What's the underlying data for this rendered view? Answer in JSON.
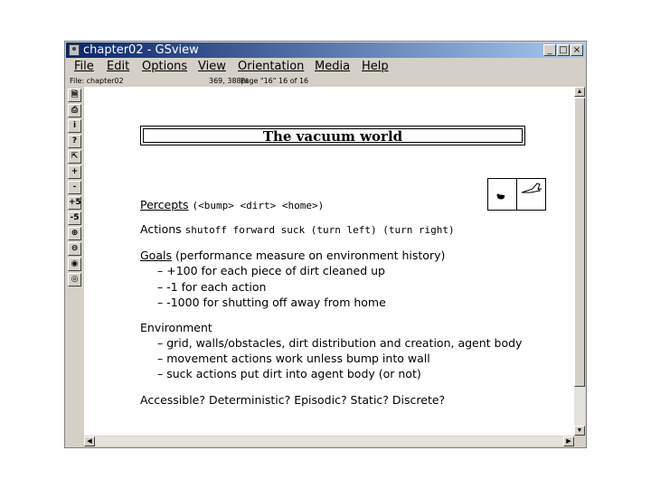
{
  "window": {
    "title": "chapter02 - GSview",
    "minimize_glyph": "_",
    "maximize_glyph": "□",
    "close_glyph": "×"
  },
  "menu": {
    "items": [
      {
        "label": "File"
      },
      {
        "label": "Edit"
      },
      {
        "label": "Options"
      },
      {
        "label": "View"
      },
      {
        "label": "Orientation"
      },
      {
        "label": "Media"
      },
      {
        "label": "Help"
      }
    ]
  },
  "status": {
    "file": "File: chapter02",
    "position": "369, 388pt",
    "page": "Page \"16\"   16 of 16"
  },
  "toolbar": {
    "buttons": [
      {
        "icon": "open-file-icon",
        "glyph": "🗎"
      },
      {
        "icon": "print-icon",
        "glyph": "⎙"
      },
      {
        "icon": "info-icon",
        "glyph": "i"
      },
      {
        "icon": "help-icon",
        "glyph": "?"
      },
      {
        "icon": "goto-page-icon",
        "glyph": "⇱"
      },
      {
        "icon": "next-page-icon",
        "glyph": "+"
      },
      {
        "icon": "prev-page-icon",
        "glyph": "-"
      },
      {
        "icon": "skip-forward-icon",
        "glyph": "+5"
      },
      {
        "icon": "skip-back-icon",
        "glyph": "-5"
      },
      {
        "icon": "zoom-in-icon",
        "glyph": "⊕"
      },
      {
        "icon": "zoom-out-icon",
        "glyph": "⊖"
      },
      {
        "icon": "find-icon",
        "glyph": "◉"
      },
      {
        "icon": "find-next-icon",
        "glyph": "◎"
      }
    ]
  },
  "slide": {
    "title": "The vacuum world",
    "percepts_label": "Percepts",
    "percepts_value": "(<bump> <dirt> <home>)",
    "actions_label": "Actions",
    "actions_value": "shutoff forward suck (turn left) (turn right)",
    "goals_label": "Goals",
    "goals_value": "(performance measure on environment history)",
    "goals_items": [
      "– +100 for each piece of dirt cleaned up",
      "– -1 for each action",
      "– -1000 for shutting off away from home"
    ],
    "environment_label": "Environment",
    "environment_items": [
      "– grid, walls/obstacles, dirt distribution and creation, agent body",
      "– movement actions work unless bump into wall",
      "– suck actions put dirt into agent body (or not)"
    ],
    "questions": "Accessible? Deterministic? Episodic? Static? Discrete?"
  },
  "colors": {
    "titlebar_start": "#0a246a",
    "titlebar_end": "#a6caf0",
    "chrome": "#d4d0c8"
  }
}
